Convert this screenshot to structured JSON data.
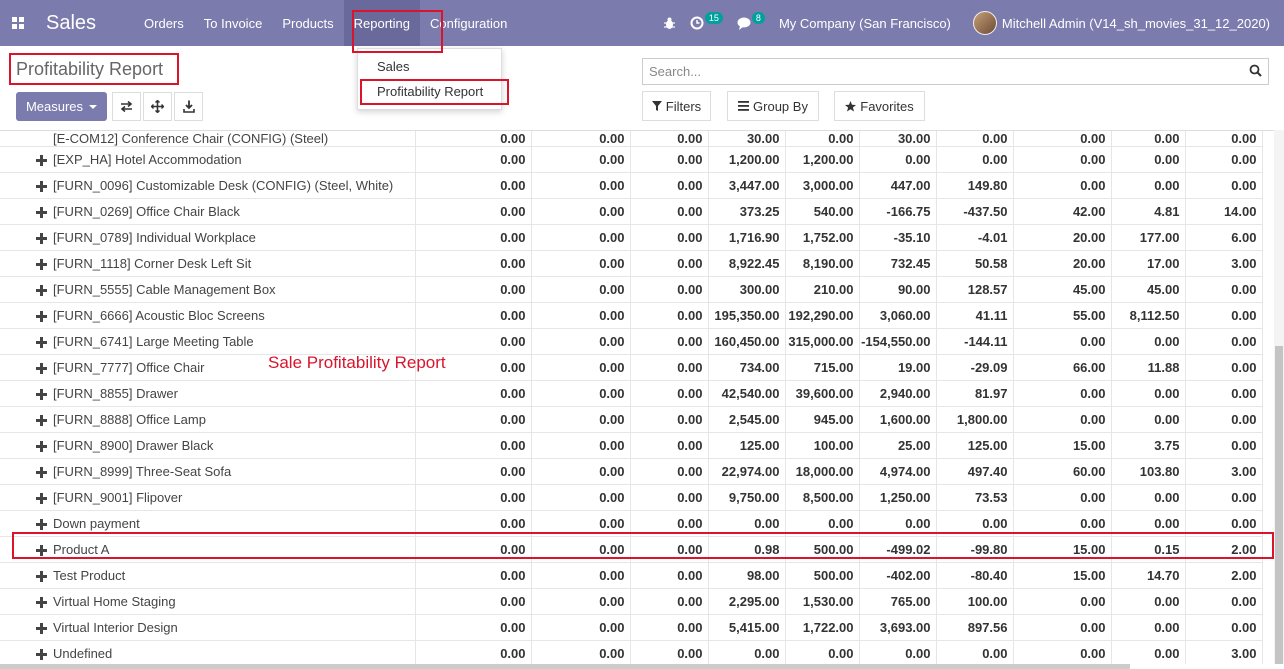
{
  "navbar": {
    "app_name": "Sales",
    "menu": [
      "Orders",
      "To Invoice",
      "Products",
      "Reporting",
      "Configuration"
    ],
    "activity_count": "15",
    "message_count": "8",
    "company": "My Company (San Francisco)",
    "user": "Mitchell Admin (V14_sh_movies_31_12_2020)"
  },
  "dropdown": {
    "items": [
      "Sales",
      "Profitability Report"
    ]
  },
  "control": {
    "title": "Profitability Report",
    "measures_label": "Measures",
    "search_placeholder": "Search...",
    "filters_label": "Filters",
    "groupby_label": "Group By",
    "favorites_label": "Favorites"
  },
  "annotation": "Sale Profitability Report",
  "table": {
    "first_row": {
      "label": "[E-COM12] Conference Chair (CONFIG) (Steel)",
      "values": [
        "0.00",
        "0.00",
        "0.00",
        "30.00",
        "0.00",
        "30.00",
        "0.00",
        "0.00",
        "0.00",
        "0.00"
      ]
    },
    "rows": [
      {
        "label": "[EXP_HA] Hotel Accommodation",
        "values": [
          "0.00",
          "0.00",
          "0.00",
          "1,200.00",
          "1,200.00",
          "0.00",
          "0.00",
          "0.00",
          "0.00",
          "0.00"
        ]
      },
      {
        "label": "[FURN_0096] Customizable Desk (CONFIG) (Steel, White)",
        "values": [
          "0.00",
          "0.00",
          "0.00",
          "3,447.00",
          "3,000.00",
          "447.00",
          "149.80",
          "0.00",
          "0.00",
          "0.00"
        ]
      },
      {
        "label": "[FURN_0269] Office Chair Black",
        "values": [
          "0.00",
          "0.00",
          "0.00",
          "373.25",
          "540.00",
          "-166.75",
          "-437.50",
          "42.00",
          "4.81",
          "14.00"
        ]
      },
      {
        "label": "[FURN_0789] Individual Workplace",
        "values": [
          "0.00",
          "0.00",
          "0.00",
          "1,716.90",
          "1,752.00",
          "-35.10",
          "-4.01",
          "20.00",
          "177.00",
          "6.00"
        ]
      },
      {
        "label": "[FURN_1118] Corner Desk Left Sit",
        "values": [
          "0.00",
          "0.00",
          "0.00",
          "8,922.45",
          "8,190.00",
          "732.45",
          "50.58",
          "20.00",
          "17.00",
          "3.00"
        ]
      },
      {
        "label": "[FURN_5555] Cable Management Box",
        "values": [
          "0.00",
          "0.00",
          "0.00",
          "300.00",
          "210.00",
          "90.00",
          "128.57",
          "45.00",
          "45.00",
          "0.00"
        ]
      },
      {
        "label": "[FURN_6666] Acoustic Bloc Screens",
        "values": [
          "0.00",
          "0.00",
          "0.00",
          "195,350.00",
          "192,290.00",
          "3,060.00",
          "41.11",
          "55.00",
          "8,112.50",
          "0.00"
        ]
      },
      {
        "label": "[FURN_6741] Large Meeting Table",
        "values": [
          "0.00",
          "0.00",
          "0.00",
          "160,450.00",
          "315,000.00",
          "-154,550.00",
          "-144.11",
          "0.00",
          "0.00",
          "0.00"
        ]
      },
      {
        "label": "[FURN_7777] Office Chair",
        "values": [
          "0.00",
          "0.00",
          "0.00",
          "734.00",
          "715.00",
          "19.00",
          "-29.09",
          "66.00",
          "11.88",
          "0.00"
        ]
      },
      {
        "label": "[FURN_8855] Drawer",
        "values": [
          "0.00",
          "0.00",
          "0.00",
          "42,540.00",
          "39,600.00",
          "2,940.00",
          "81.97",
          "0.00",
          "0.00",
          "0.00"
        ]
      },
      {
        "label": "[FURN_8888] Office Lamp",
        "values": [
          "0.00",
          "0.00",
          "0.00",
          "2,545.00",
          "945.00",
          "1,600.00",
          "1,800.00",
          "0.00",
          "0.00",
          "0.00"
        ]
      },
      {
        "label": "[FURN_8900] Drawer Black",
        "values": [
          "0.00",
          "0.00",
          "0.00",
          "125.00",
          "100.00",
          "25.00",
          "125.00",
          "15.00",
          "3.75",
          "0.00"
        ]
      },
      {
        "label": "[FURN_8999] Three-Seat Sofa",
        "values": [
          "0.00",
          "0.00",
          "0.00",
          "22,974.00",
          "18,000.00",
          "4,974.00",
          "497.40",
          "60.00",
          "103.80",
          "3.00"
        ]
      },
      {
        "label": "[FURN_9001] Flipover",
        "values": [
          "0.00",
          "0.00",
          "0.00",
          "9,750.00",
          "8,500.00",
          "1,250.00",
          "73.53",
          "0.00",
          "0.00",
          "0.00"
        ]
      },
      {
        "label": "Down payment",
        "values": [
          "0.00",
          "0.00",
          "0.00",
          "0.00",
          "0.00",
          "0.00",
          "0.00",
          "0.00",
          "0.00",
          "0.00"
        ]
      },
      {
        "label": "Product A",
        "values": [
          "0.00",
          "0.00",
          "0.00",
          "0.98",
          "500.00",
          "-499.02",
          "-99.80",
          "15.00",
          "0.15",
          "2.00"
        ]
      },
      {
        "label": "Test Product",
        "values": [
          "0.00",
          "0.00",
          "0.00",
          "98.00",
          "500.00",
          "-402.00",
          "-80.40",
          "15.00",
          "14.70",
          "2.00"
        ]
      },
      {
        "label": "Virtual Home Staging",
        "values": [
          "0.00",
          "0.00",
          "0.00",
          "2,295.00",
          "1,530.00",
          "765.00",
          "100.00",
          "0.00",
          "0.00",
          "0.00"
        ]
      },
      {
        "label": "Virtual Interior Design",
        "values": [
          "0.00",
          "0.00",
          "0.00",
          "5,415.00",
          "1,722.00",
          "3,693.00",
          "897.56",
          "0.00",
          "0.00",
          "0.00"
        ]
      },
      {
        "label": "Undefined",
        "values": [
          "0.00",
          "0.00",
          "0.00",
          "0.00",
          "0.00",
          "0.00",
          "0.00",
          "0.00",
          "0.00",
          "3.00"
        ]
      }
    ]
  }
}
